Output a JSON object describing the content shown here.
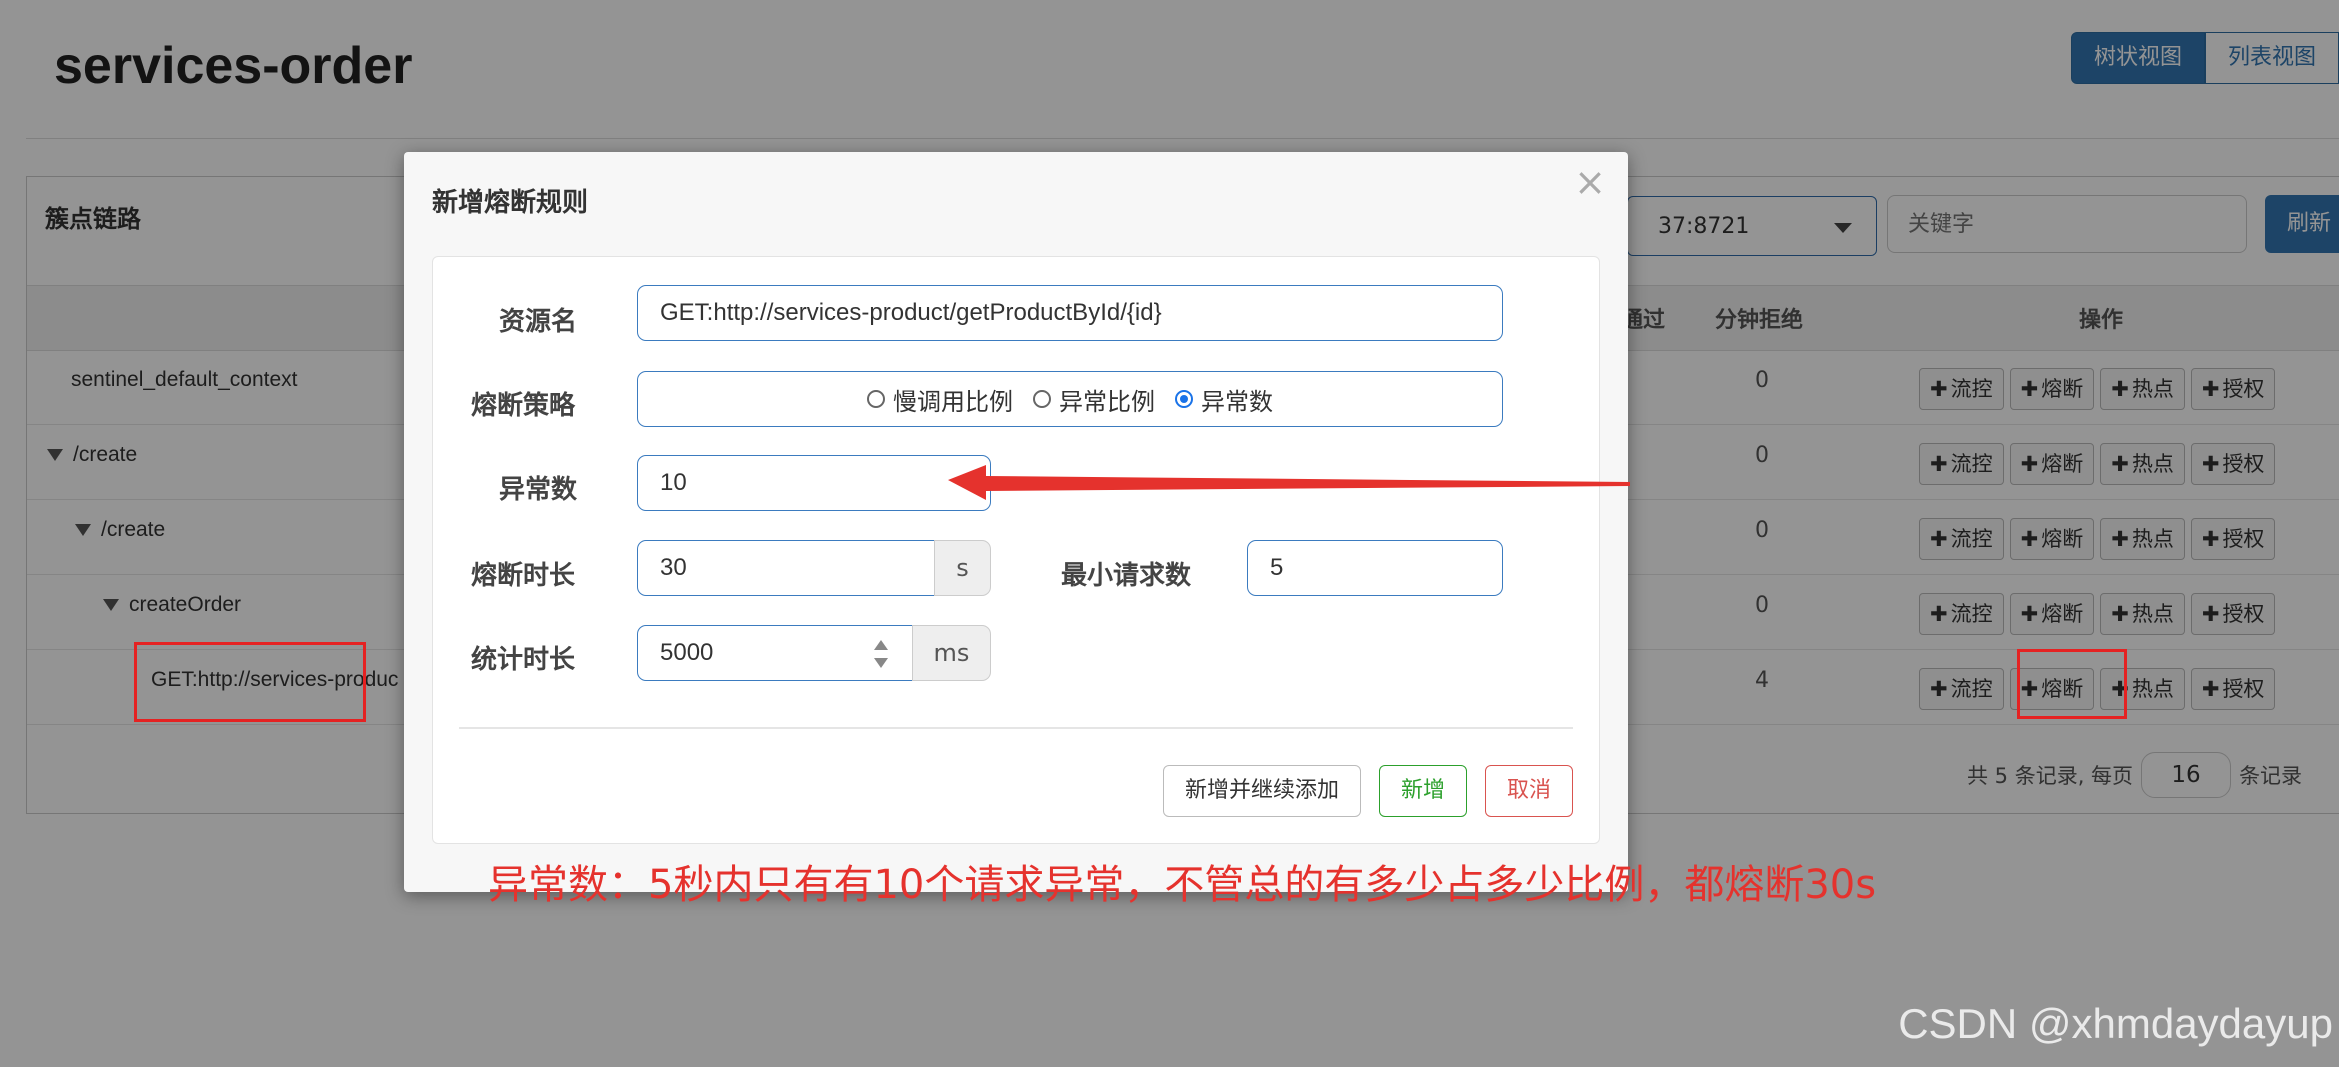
{
  "app": {
    "title": "services-order"
  },
  "view_toggle": {
    "tree": "树状视图",
    "list": "列表视图"
  },
  "panel": {
    "title": "簇点链路",
    "machine_value": "37:8721",
    "search_placeholder": "关键字",
    "refresh_label": "刷新"
  },
  "table": {
    "headers": {
      "passed": "通过",
      "rejected": "分钟拒绝",
      "ops": "操作"
    },
    "rows": [
      {
        "name": "sentinel_default_context",
        "rejected": "0"
      },
      {
        "name": "/create",
        "rejected": "0"
      },
      {
        "name": "/create",
        "rejected": "0"
      },
      {
        "name": "createOrder",
        "rejected": "0"
      },
      {
        "name": "GET:http://services-produc",
        "rejected": "4"
      }
    ],
    "op_buttons": [
      "流控",
      "熔断",
      "热点",
      "授权"
    ]
  },
  "pager": {
    "prefix": "共 5 条记录, 每页",
    "page_size": "16",
    "suffix": "条记录"
  },
  "modal": {
    "title": "新增熔断规则",
    "close": "×",
    "resource_label": "资源名",
    "resource_value": "GET:http://services-product/getProductById/{id}",
    "strategy_label": "熔断策略",
    "strategies": [
      "慢调用比例",
      "异常比例",
      "异常数"
    ],
    "strategy_selected": "异常数",
    "count_label": "异常数",
    "count_value": "10",
    "duration_label": "熔断时长",
    "duration_value": "30",
    "duration_unit": "s",
    "min_request_label": "最小请求数",
    "min_request_value": "5",
    "stat_label": "统计时长",
    "stat_value": "5000",
    "stat_unit": "ms",
    "add_continue": "新增并继续添加",
    "add": "新增",
    "cancel": "取消"
  },
  "annotation": "异常数：5秒内只有有10个请求异常，不管总的有多少占多少比例，都熔断30s",
  "watermark": "CSDN @xhmdaydayup",
  "colors": {
    "primary": "#3276b1",
    "annotation_red": "#e5322d",
    "success": "#2ca02c",
    "danger": "#d9534f"
  }
}
